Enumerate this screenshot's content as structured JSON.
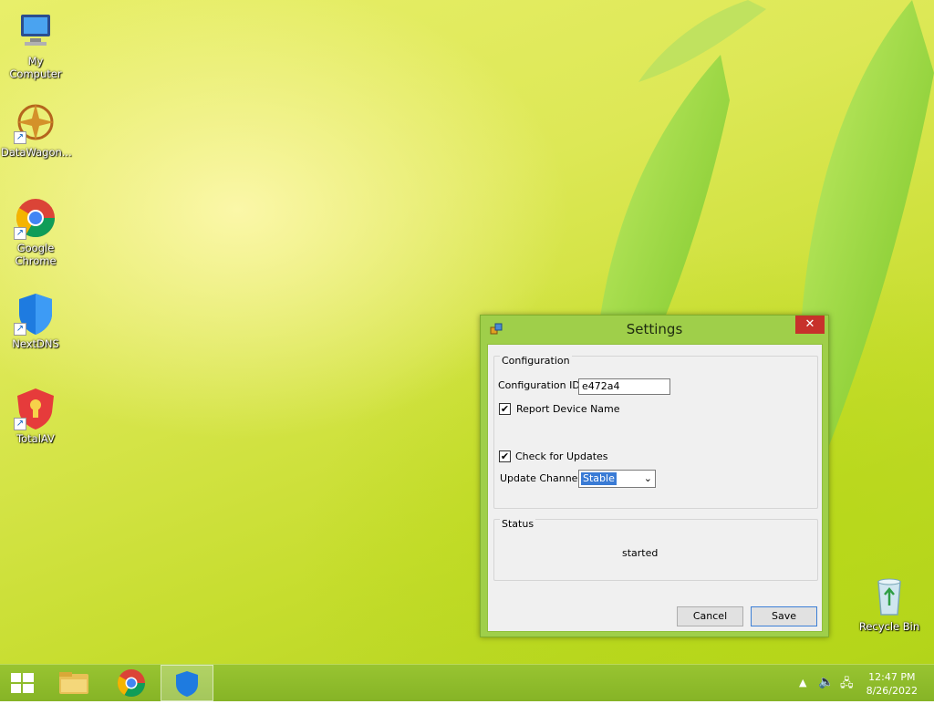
{
  "desktop": {
    "icons": [
      {
        "label": "My Computer"
      },
      {
        "label": "DataWagon..."
      },
      {
        "label": "Google Chrome"
      },
      {
        "label": "NextDNS"
      },
      {
        "label": "TotalAV"
      },
      {
        "label": "Recycle Bin"
      }
    ]
  },
  "window": {
    "title": "Settings",
    "close_glyph": "✕",
    "configuration": {
      "legend": "Configuration",
      "config_id_label": "Configuration ID:",
      "config_id_value": "e472a4",
      "report_device_name_label": "Report Device Name",
      "report_device_name_checked": true,
      "check_updates_label": "Check for Updates",
      "check_updates_checked": true,
      "update_channel_label": "Update Channel:",
      "update_channel_value": "Stable"
    },
    "status": {
      "legend": "Status",
      "text": "started"
    },
    "buttons": {
      "cancel": "Cancel",
      "save": "Save"
    }
  },
  "taskbar": {
    "clock_time": "12:47 PM",
    "clock_date": "8/26/2022"
  },
  "colors": {
    "accent": "#3a7bd5",
    "close": "#c7312b",
    "window_frame": "#9fcf4a"
  }
}
